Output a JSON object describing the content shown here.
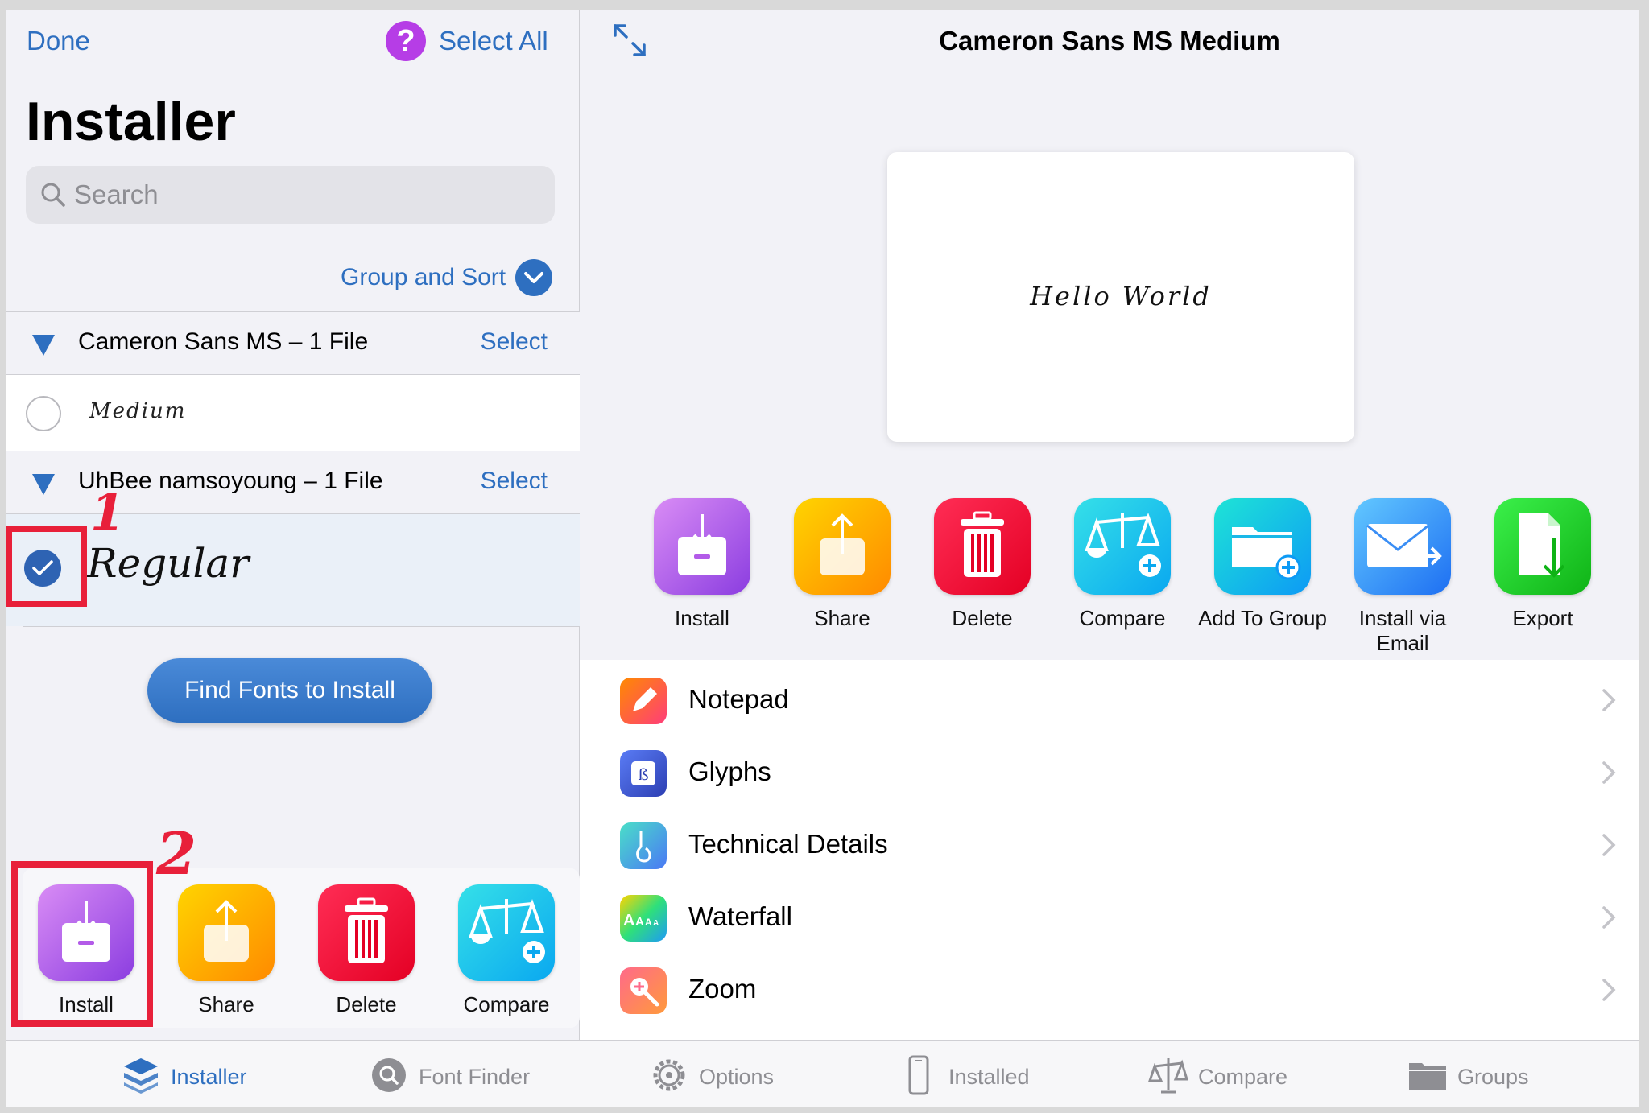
{
  "left_pane": {
    "done_label": "Done",
    "help_icon_glyph": "?",
    "select_all_label": "Select All",
    "title": "Installer",
    "search_placeholder": "Search",
    "group_sort_label": "Group and Sort",
    "groups": [
      {
        "title": "Cameron Sans MS – 1 File",
        "select_label": "Select",
        "fonts": [
          {
            "style": "Medium",
            "checked": false
          }
        ]
      },
      {
        "title": "UhBee namsoyoung – 1 File",
        "select_label": "Select",
        "fonts": [
          {
            "style": "Regular",
            "checked": true
          }
        ]
      }
    ],
    "find_fonts_label": "Find Fonts to Install",
    "actions": [
      {
        "label": "Install",
        "icon": "install-icon"
      },
      {
        "label": "Share",
        "icon": "share-icon"
      },
      {
        "label": "Delete",
        "icon": "trash-icon"
      },
      {
        "label": "Compare",
        "icon": "scales-icon"
      }
    ]
  },
  "annotations": {
    "step1": "1",
    "step2": "2",
    "color": "#e8203a"
  },
  "right_pane": {
    "title": "Cameron Sans MS Medium",
    "preview_text": "Hello World",
    "actions": [
      {
        "label": "Install",
        "icon": "install-icon"
      },
      {
        "label": "Share",
        "icon": "share-icon"
      },
      {
        "label": "Delete",
        "icon": "trash-icon"
      },
      {
        "label": "Compare",
        "icon": "scales-icon"
      },
      {
        "label": "Add To Group",
        "icon": "folder-add-icon"
      },
      {
        "label": "Install via Email",
        "icon": "mail-icon"
      },
      {
        "label": "Export",
        "icon": "export-icon"
      }
    ],
    "detail_items": [
      {
        "label": "Notepad",
        "icon": "pencil-icon"
      },
      {
        "label": "Glyphs",
        "icon": "glyph-icon"
      },
      {
        "label": "Technical Details",
        "icon": "technical-icon"
      },
      {
        "label": "Waterfall",
        "icon": "waterfall-icon"
      },
      {
        "label": "Zoom",
        "icon": "zoom-icon"
      }
    ]
  },
  "tabbar": [
    {
      "label": "Installer",
      "icon": "installer-stack-icon",
      "active": true
    },
    {
      "label": "Font Finder",
      "icon": "search-icon",
      "active": false
    },
    {
      "label": "Options",
      "icon": "gear-icon",
      "active": false
    },
    {
      "label": "Installed",
      "icon": "phone-icon",
      "active": false
    },
    {
      "label": "Compare",
      "icon": "scales-icon",
      "active": false
    },
    {
      "label": "Groups",
      "icon": "folder-icon",
      "active": false
    }
  ],
  "colors": {
    "accent": "#2e6fc0",
    "annotation": "#e8203a"
  }
}
